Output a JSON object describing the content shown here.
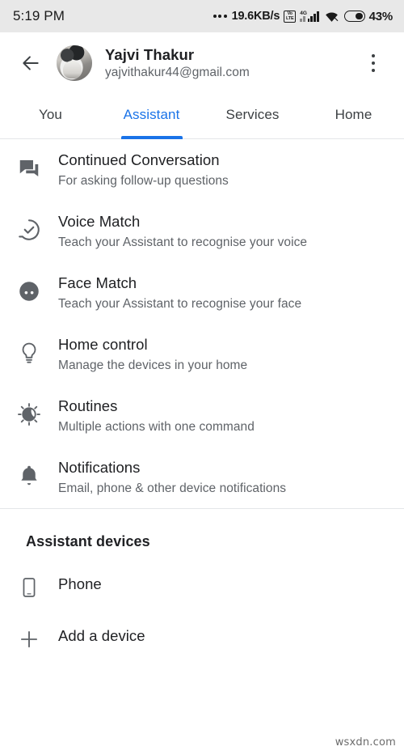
{
  "status_bar": {
    "time": "5:19 PM",
    "network_speed": "19.6KB/s",
    "volte_line1": "Vo",
    "volte_line2": "LTE",
    "network_type": "4G",
    "battery_percent": "43%",
    "icons": [
      "more-dots-icon",
      "volte-icon",
      "signal-bars-icon",
      "wifi-icon",
      "battery-icon"
    ]
  },
  "header": {
    "back_icon": "back-arrow-icon",
    "avatar_alt": "account-avatar",
    "name": "Yajvi Thakur",
    "email": "yajvithakur44@gmail.com",
    "overflow_icon": "more-vertical-icon"
  },
  "tabs": {
    "active_index": 1,
    "items": [
      {
        "label": "You"
      },
      {
        "label": "Assistant"
      },
      {
        "label": "Services"
      },
      {
        "label": "Home"
      }
    ],
    "accent_color": "#1a73e8"
  },
  "settings": {
    "items": [
      {
        "icon": "forum-icon",
        "title": "Continued Conversation",
        "subtitle": "For asking follow-up questions"
      },
      {
        "icon": "voice-match-check-icon",
        "title": "Voice Match",
        "subtitle": "Teach your Assistant to recognise your voice"
      },
      {
        "icon": "face-match-icon",
        "title": "Face Match",
        "subtitle": "Teach your Assistant to recognise your face"
      },
      {
        "icon": "lightbulb-icon",
        "title": "Home control",
        "subtitle": "Manage the devices in your home"
      },
      {
        "icon": "routines-sun-moon-icon",
        "title": "Routines",
        "subtitle": "Multiple actions with one command"
      },
      {
        "icon": "bell-icon",
        "title": "Notifications",
        "subtitle": "Email, phone & other device notifications"
      }
    ]
  },
  "devices_section": {
    "header": "Assistant devices",
    "items": [
      {
        "icon": "phone-icon",
        "label": "Phone"
      },
      {
        "icon": "plus-icon",
        "label": "Add a device"
      }
    ]
  },
  "watermark": "wsxdn.com",
  "colors": {
    "accent": "#1a73e8",
    "primary_text": "#202124",
    "secondary_text": "#5f6368",
    "icon": "#5f6368",
    "divider": "#e4e6e8",
    "status_bar_bg": "#e8e8e8"
  }
}
